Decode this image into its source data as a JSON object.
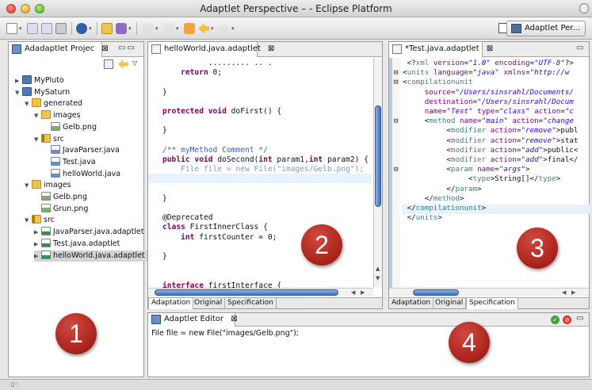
{
  "window": {
    "title": "Adaptlet Perspective – - Eclipse Platform",
    "perspective_label": "Adaptlet Per..."
  },
  "explorer": {
    "tab_label": "Adadaptlet Projec",
    "tree": [
      {
        "label": "MyPluto",
        "icon": "project-icon",
        "depth": 0,
        "twisty": "closed"
      },
      {
        "label": "MySaturn",
        "icon": "project-icon",
        "depth": 0,
        "twisty": "open"
      },
      {
        "label": "generated",
        "icon": "folder-icon",
        "depth": 1,
        "twisty": "open"
      },
      {
        "label": "images",
        "icon": "folder-icon",
        "depth": 2,
        "twisty": "open"
      },
      {
        "label": "Gelb.png",
        "icon": "image-file-icon",
        "depth": 3,
        "twisty": ""
      },
      {
        "label": "src",
        "icon": "package-folder-icon",
        "depth": 2,
        "twisty": "open"
      },
      {
        "label": "JavaParser.java",
        "icon": "java-file-icon",
        "depth": 3,
        "twisty": ""
      },
      {
        "label": "Test.java",
        "icon": "java-file-icon",
        "depth": 3,
        "twisty": ""
      },
      {
        "label": "helloWorld.java",
        "icon": "java-file-icon",
        "depth": 3,
        "twisty": ""
      },
      {
        "label": "images",
        "icon": "folder-icon",
        "depth": 1,
        "twisty": "open"
      },
      {
        "label": "Gelb.png",
        "icon": "image-file-icon",
        "depth": 2,
        "twisty": ""
      },
      {
        "label": "Grun.png",
        "icon": "image-file-icon",
        "depth": 2,
        "twisty": ""
      },
      {
        "label": "src",
        "icon": "package-folder-icon",
        "depth": 1,
        "twisty": "open"
      },
      {
        "label": "JavaParser.java.adaptlet",
        "icon": "adaptlet-file-icon",
        "depth": 2,
        "twisty": "closed"
      },
      {
        "label": "Test.java.adaptlet",
        "icon": "adaptlet-file-icon",
        "depth": 2,
        "twisty": "closed"
      },
      {
        "label": "helloWorld.java.adaptlet",
        "icon": "adaptlet-file-icon",
        "depth": 2,
        "twisty": "closed",
        "selected": true
      }
    ]
  },
  "java_editor": {
    "tab_label": "helloWorld.java.adaptlet",
    "bottom_tabs": [
      "Adaptation",
      "Original",
      "Specification"
    ],
    "selected_tab": "Adaptation"
  },
  "xml_editor": {
    "tab_label": "*Test.java.adaptlet",
    "bottom_tabs": [
      "Adaptation",
      "Original",
      "Specification"
    ],
    "selected_tab": "Specification"
  },
  "adaptlet_editor": {
    "tab_label": "Adaptlet Editor",
    "content": "File file = new File(\"images/Gelb.png\");"
  },
  "markers": [
    "1",
    "2",
    "3",
    "4"
  ],
  "colors": {
    "marker": "#b52a22",
    "keyword": "#7f0055",
    "comment": "#3f5fbf",
    "string": "#2a00ff",
    "highlight_line": "#e8f2fe"
  }
}
